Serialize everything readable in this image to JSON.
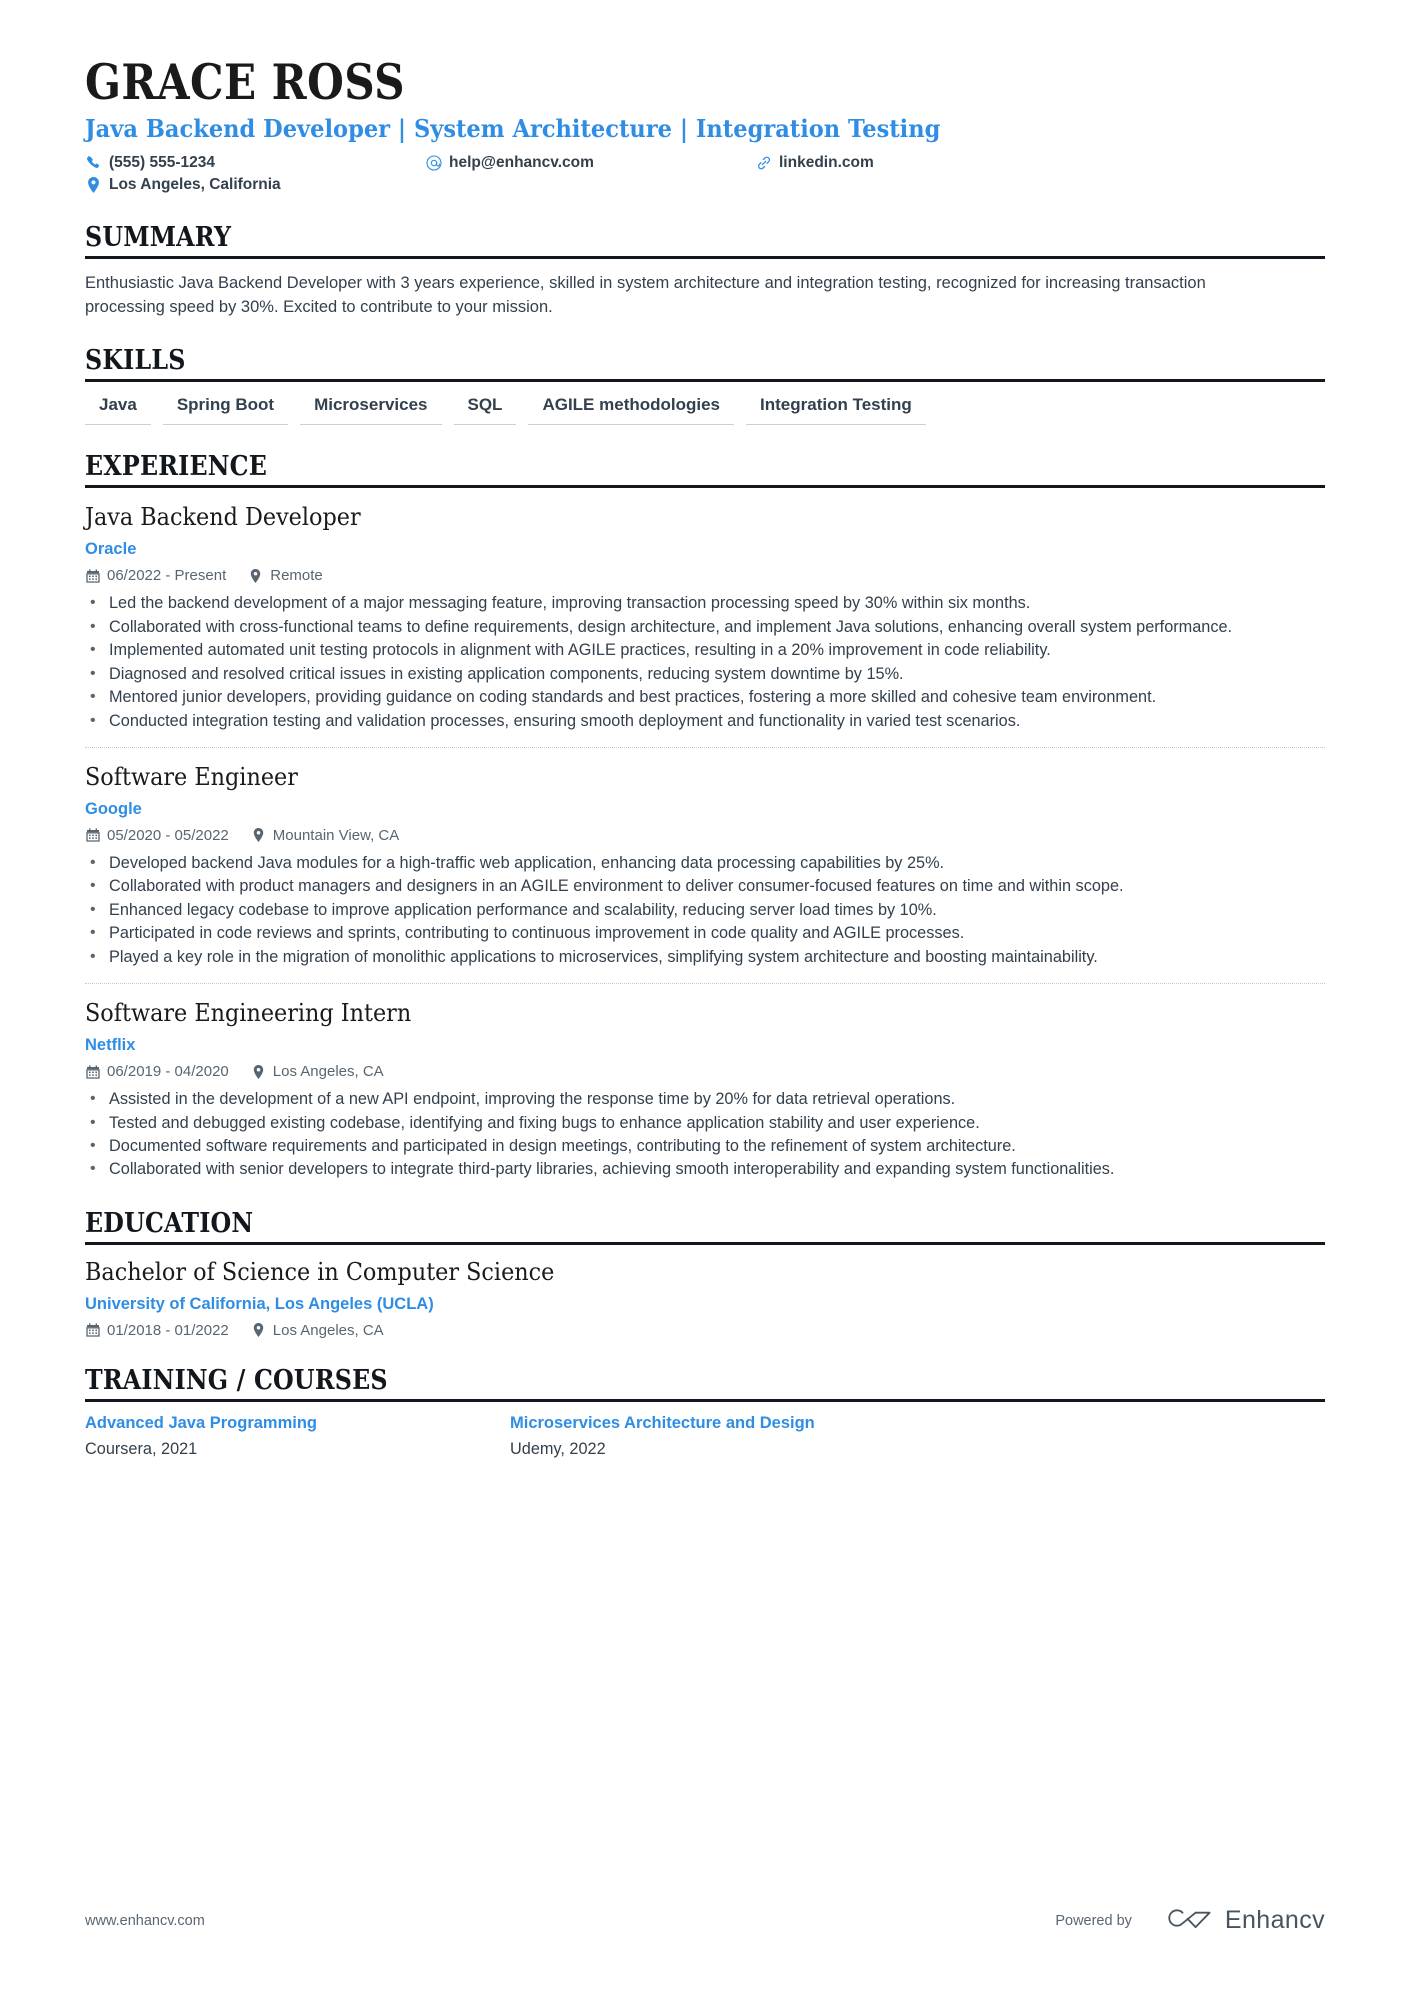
{
  "header": {
    "name": "GRACE ROSS",
    "headline": "Java Backend Developer | System Architecture | Integration Testing",
    "contacts": [
      {
        "icon": "phone-icon",
        "value": "(555) 555-1234"
      },
      {
        "icon": "email-icon",
        "value": "help@enhancv.com"
      },
      {
        "icon": "link-icon",
        "value": "linkedin.com"
      },
      {
        "icon": "location-pin-icon",
        "value": "Los Angeles, California"
      }
    ]
  },
  "sections": {
    "summary": {
      "title": "SUMMARY",
      "text": "Enthusiastic Java Backend Developer with 3 years experience, skilled in system architecture and integration testing, recognized for increasing transaction processing speed by 30%. Excited to contribute to your mission."
    },
    "skills": {
      "title": "SKILLS",
      "items": [
        "Java",
        "Spring Boot",
        "Microservices",
        "SQL",
        "AGILE methodologies",
        "Integration Testing"
      ]
    },
    "experience": {
      "title": "EXPERIENCE",
      "jobs": [
        {
          "title": "Java Backend Developer",
          "company": "Oracle",
          "dates": "06/2022 - Present",
          "location": "Remote",
          "bullets": [
            "Led the backend development of a major messaging feature, improving transaction processing speed by 30% within six months.",
            "Collaborated with cross-functional teams to define requirements, design architecture, and implement Java solutions, enhancing overall system performance.",
            "Implemented automated unit testing protocols in alignment with AGILE practices, resulting in a 20% improvement in code reliability.",
            "Diagnosed and resolved critical issues in existing application components, reducing system downtime by 15%.",
            "Mentored junior developers, providing guidance on coding standards and best practices, fostering a more skilled and cohesive team environment.",
            "Conducted integration testing and validation processes, ensuring smooth deployment and functionality in varied test scenarios."
          ]
        },
        {
          "title": "Software Engineer",
          "company": "Google",
          "dates": "05/2020 - 05/2022",
          "location": "Mountain View, CA",
          "bullets": [
            "Developed backend Java modules for a high-traffic web application, enhancing data processing capabilities by 25%.",
            "Collaborated with product managers and designers in an AGILE environment to deliver consumer-focused features on time and within scope.",
            "Enhanced legacy codebase to improve application performance and scalability, reducing server load times by 10%.",
            "Participated in code reviews and sprints, contributing to continuous improvement in code quality and AGILE processes.",
            "Played a key role in the migration of monolithic applications to microservices, simplifying system architecture and boosting maintainability."
          ]
        },
        {
          "title": "Software Engineering Intern",
          "company": "Netflix",
          "dates": "06/2019 - 04/2020",
          "location": "Los Angeles, CA",
          "bullets": [
            "Assisted in the development of a new API endpoint, improving the response time by 20% for data retrieval operations.",
            "Tested and debugged existing codebase, identifying and fixing bugs to enhance application stability and user experience.",
            "Documented software requirements and participated in design meetings, contributing to the refinement of system architecture.",
            "Collaborated with senior developers to integrate third-party libraries, achieving smooth interoperability and expanding system functionalities."
          ]
        }
      ]
    },
    "education": {
      "title": "EDUCATION",
      "entries": [
        {
          "degree": "Bachelor of Science in Computer Science",
          "school": "University of California, Los Angeles (UCLA)",
          "dates": "01/2018 - 01/2022",
          "location": "Los Angeles, CA"
        }
      ]
    },
    "training": {
      "title": "TRAINING / COURSES",
      "courses": [
        {
          "name": "Advanced Java Programming",
          "meta": "Coursera, 2021"
        },
        {
          "name": "Microservices Architecture and Design",
          "meta": "Udemy, 2022"
        }
      ]
    }
  },
  "footer": {
    "url": "www.enhancv.com",
    "powered_by": "Powered by",
    "brand": "Enhancv"
  },
  "colors": {
    "accent_blue": "#2f8de4",
    "text_dark": "#33404d",
    "heading_black": "#12171d",
    "meta_gray": "#59656f",
    "rule_gray": "#c9d0d6"
  }
}
